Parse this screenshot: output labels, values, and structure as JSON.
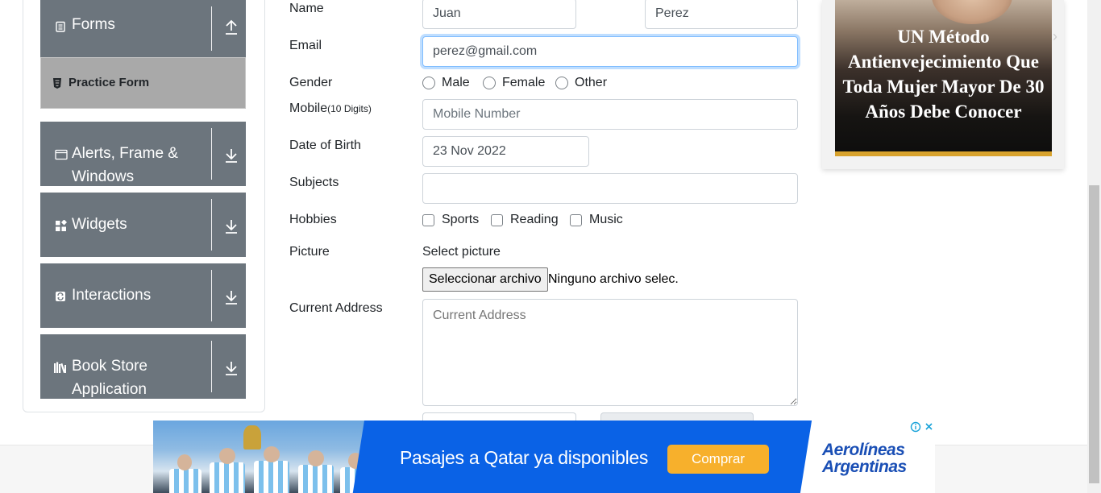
{
  "sidebar": {
    "groups": [
      {
        "title": "Forms",
        "icon": "clipboard-icon",
        "expanded": true
      },
      {
        "title": "Alerts, Frame & Windows",
        "icon": "window-icon",
        "expanded": false
      },
      {
        "title": "Widgets",
        "icon": "widgets-icon",
        "expanded": false
      },
      {
        "title": "Interactions",
        "icon": "interactions-icon",
        "expanded": false
      },
      {
        "title": "Book Store Application",
        "icon": "books-icon",
        "expanded": false
      }
    ],
    "active_item": "Practice Form"
  },
  "form": {
    "name_label": "Name",
    "first_name": "Juan",
    "last_name": "Perez",
    "email_label": "Email",
    "email": "perez@gmail.com",
    "gender_label": "Gender",
    "genders": [
      "Male",
      "Female",
      "Other"
    ],
    "mobile_label": "Mobile",
    "mobile_hint": "(10 Digits)",
    "mobile_placeholder": "Mobile Number",
    "dob_label": "Date of Birth",
    "dob": "23 Nov 2022",
    "subjects_label": "Subjects",
    "hobbies_label": "Hobbies",
    "hobbies": [
      "Sports",
      "Reading",
      "Music"
    ],
    "picture_label": "Picture",
    "picture_caption": "Select picture",
    "file_button": "Seleccionar archivo",
    "file_status": "Ninguno archivo selec.",
    "address_label": "Current Address",
    "address_placeholder": "Current Address"
  },
  "ad_right": {
    "text": "UN Método Antienvejecimiento Que Toda Mujer Mayor De 30 Años Debe Conocer"
  },
  "banner": {
    "headline": "Pasajes a Qatar ya disponibles",
    "button": "Comprar",
    "brand": "Aerolíneas Argentinas",
    "accent": "#0a62e6",
    "button_color": "#f7b02c"
  },
  "colors": {
    "sidebar_group": "#6c757d",
    "active_item": "#a9a9a9",
    "focus_border": "#80bdff"
  }
}
